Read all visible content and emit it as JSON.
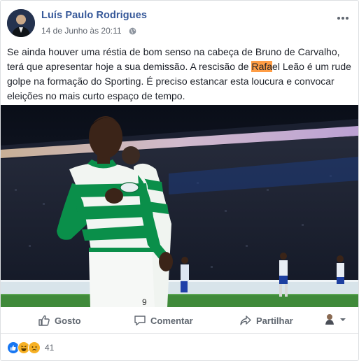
{
  "post": {
    "author": "Luís Paulo Rodrigues",
    "timestamp": "14 de Junho às 20:11",
    "audience_icon": "globe-icon",
    "more_icon": "more-options-icon",
    "text_before": "Se ainda houver uma réstia de bom senso na cabeça de Bruno de Carvalho, terá que apresentar hoje a sua demissão. A rescisão de ",
    "text_highlight": "Rafa",
    "text_after": "el Leão é um rude golpe na formação do Sporting. É preciso estancar esta loucura e convocar eleições no mais curto espaço de tempo.",
    "highlight_color": "#ff9d45",
    "jersey_number": "9"
  },
  "actions": {
    "like_label": "Gosto",
    "comment_label": "Comentar",
    "share_label": "Partilhar"
  },
  "reactions": {
    "types": [
      "like",
      "haha",
      "sad"
    ],
    "count": "41"
  },
  "colors": {
    "author_link": "#365899",
    "secondary_text": "#616770",
    "like_blue": "#1877f2",
    "sporting_green": "#0a8f4a"
  }
}
